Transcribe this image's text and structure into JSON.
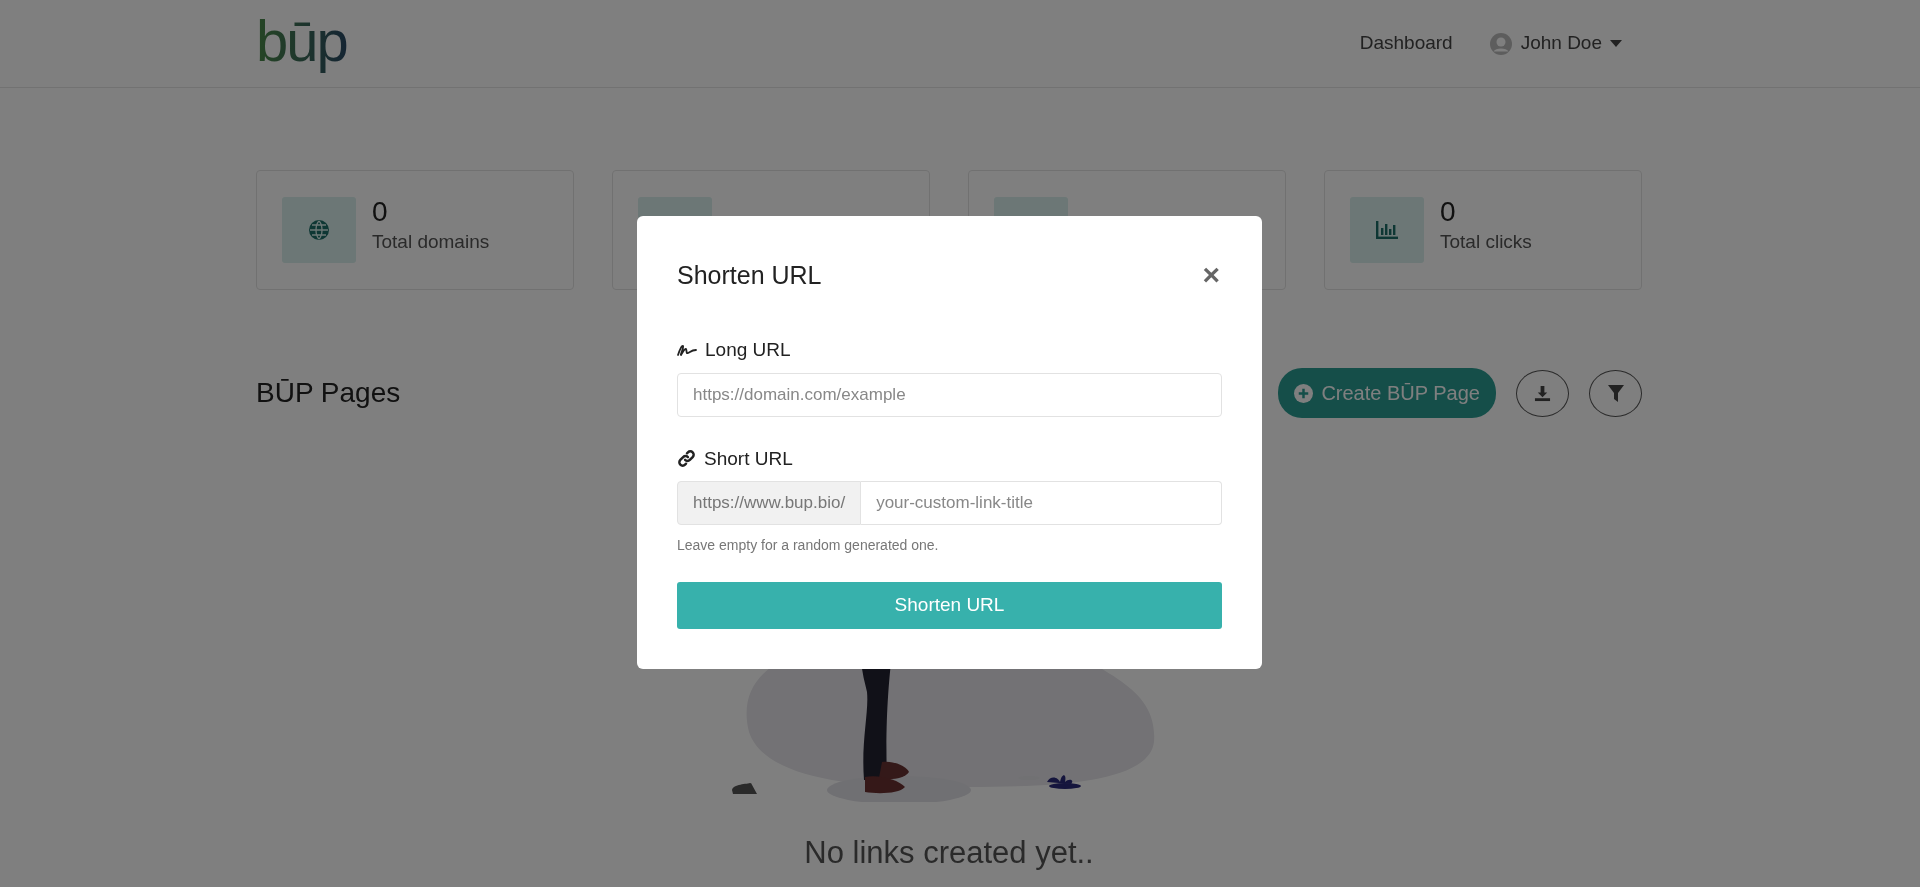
{
  "header": {
    "logo": "būp",
    "nav": [
      {
        "label": "Dashboard"
      }
    ],
    "user": {
      "name": "John Doe"
    }
  },
  "stats": [
    {
      "kind": "domains",
      "value": "0",
      "label": "Total domains"
    },
    {
      "kind": "covered"
    },
    {
      "kind": "covered"
    },
    {
      "kind": "clicks",
      "value": "0",
      "label": "Total clicks"
    }
  ],
  "section": {
    "title": "BŪP Pages",
    "create_button": "Create BŪP Page"
  },
  "empty_state": {
    "message": "No links created yet.."
  },
  "modal": {
    "title": "Shorten URL",
    "close": "×",
    "fields": [
      {
        "kind": "text",
        "label": "Long URL",
        "placeholder": "https://domain.com/example"
      },
      {
        "kind": "prefixed",
        "label": "Short URL",
        "prefix": "https://www.bup.bio/",
        "placeholder": "your-custom-link-title",
        "help": "Leave empty for a random generated one."
      }
    ],
    "submit": "Shorten URL"
  }
}
